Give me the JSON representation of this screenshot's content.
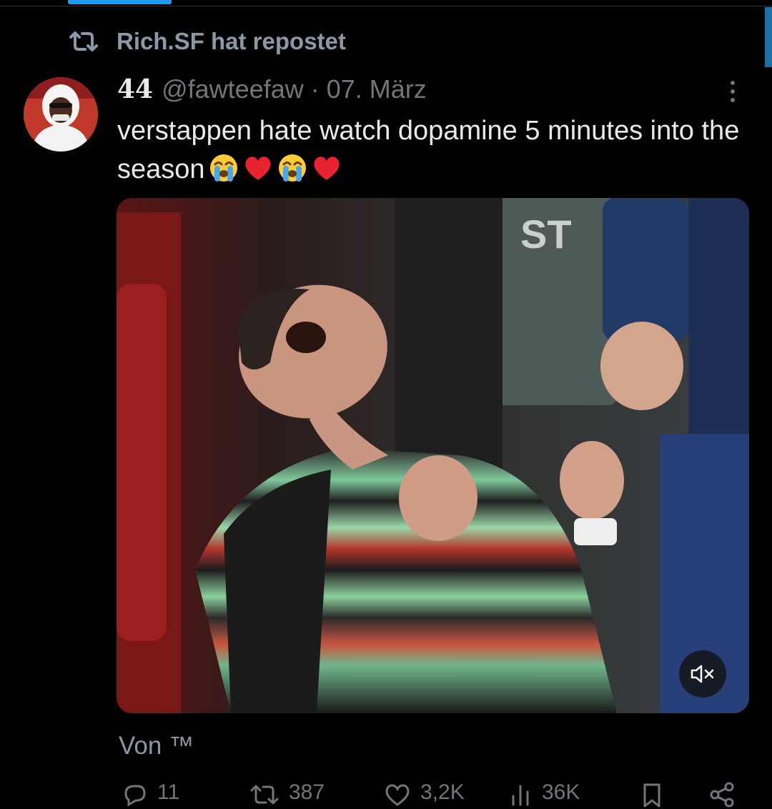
{
  "colors": {
    "background": "#000000",
    "accent": "#1d9bf0",
    "text_primary": "#e7e9ea",
    "text_secondary": "#71767b"
  },
  "repost": {
    "icon": "repost-icon",
    "text": "Rich.SF hat repostet"
  },
  "tweet": {
    "author_name": "44",
    "handle": "@fawteefaw",
    "separator": "·",
    "date": "07. März",
    "text": "verstappen hate watch dopamine 5 minutes into the season",
    "emojis": [
      "loudly-crying-face",
      "red-heart",
      "loudly-crying-face",
      "red-heart"
    ],
    "attribution": "Von ™"
  },
  "media": {
    "type": "video",
    "mute_icon": "volume-muted-icon"
  },
  "actions": [
    {
      "name": "reply",
      "icon": "reply-icon",
      "count": "11"
    },
    {
      "name": "repost",
      "icon": "repost-icon",
      "count": "387"
    },
    {
      "name": "like",
      "icon": "heart-icon",
      "count": "3,2K"
    },
    {
      "name": "views",
      "icon": "views-icon",
      "count": "36K"
    },
    {
      "name": "bookmark",
      "icon": "bookmark-icon",
      "count": ""
    },
    {
      "name": "share",
      "icon": "share-icon",
      "count": ""
    }
  ]
}
